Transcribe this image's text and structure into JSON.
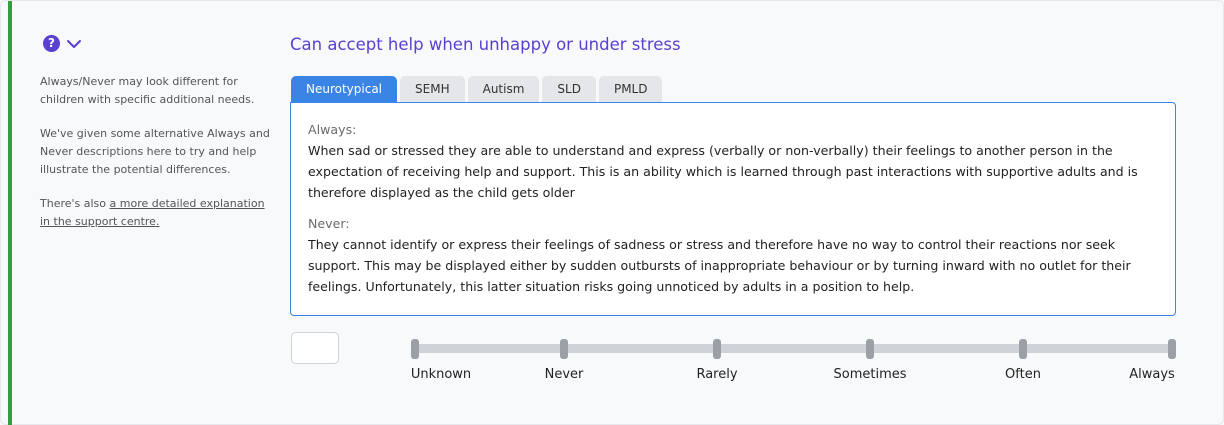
{
  "accent_color": "#2ea043",
  "help": {
    "icon": "question-circle-icon",
    "toggle_icon": "chevron-down-icon",
    "paragraph1": "Always/Never may look different for children with specific additional needs.",
    "paragraph2": "We've given some alternative Always and Never descriptions here to try and help illustrate the potential differences.",
    "paragraph3_prefix": "There's also ",
    "paragraph3_link": "a more detailed explanation in the support centre."
  },
  "title": "Can accept help when unhappy or under stress",
  "tabs": [
    {
      "label": "Neurotypical",
      "active": true
    },
    {
      "label": "SEMH",
      "active": false
    },
    {
      "label": "Autism",
      "active": false
    },
    {
      "label": "SLD",
      "active": false
    },
    {
      "label": "PMLD",
      "active": false
    }
  ],
  "panel": {
    "always_label": "Always:",
    "always_text": "When sad or stressed they are able to understand and express (verbally or non-verbally) their feelings to another person in the expectation of receiving help and support. This is an ability which is learned through past interactions with supportive adults and is therefore displayed as the child gets older",
    "never_label": "Never:",
    "never_text": "They cannot identify or express their feelings of sadness or stress and therefore have no way to control their reactions nor seek support. This may be displayed either by sudden outbursts of inappropriate behaviour or by turning inward with no outlet for their feelings. Unfortunately, this latter situation risks going unnoticed by adults in a position to help."
  },
  "score_value": "",
  "scale": {
    "labels": [
      "Unknown",
      "Never",
      "Rarely",
      "Sometimes",
      "Often",
      "Always"
    ]
  },
  "colors": {
    "accent_tab": "#3a84e6",
    "title": "#5a3fd0"
  }
}
